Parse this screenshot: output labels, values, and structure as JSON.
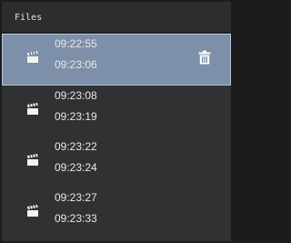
{
  "header": {
    "title": "Files"
  },
  "files": [
    {
      "start": "09:22:55",
      "end": "09:23:06",
      "icon": "clapperboard-icon",
      "selected": true
    },
    {
      "start": "09:23:08",
      "end": "09:23:19",
      "icon": "clapperboard-icon",
      "selected": false
    },
    {
      "start": "09:23:22",
      "end": "09:23:24",
      "icon": "clapperboard-icon",
      "selected": false
    },
    {
      "start": "09:23:27",
      "end": "09:23:33",
      "icon": "clapperboard-icon",
      "selected": false
    }
  ],
  "actions": {
    "delete_icon": "trash-icon"
  },
  "colors": {
    "panel_bg": "#303133",
    "selected_bg": "#7d8fa9",
    "text": "#e8e8e8"
  }
}
